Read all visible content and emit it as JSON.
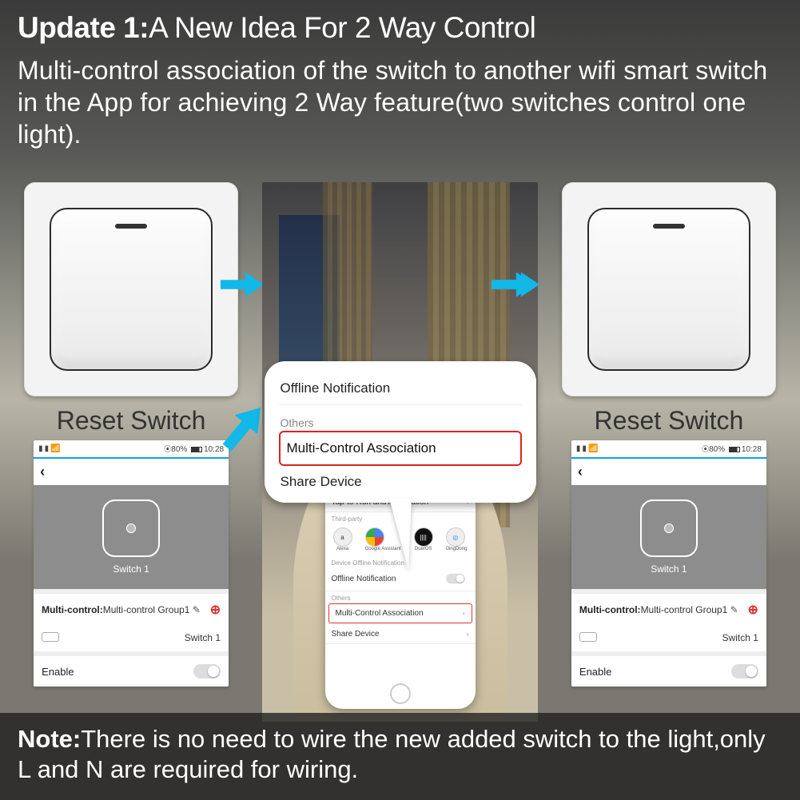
{
  "header": {
    "title_prefix": "Update 1:",
    "title_rest": "A New Idea For 2 Way Control",
    "subtitle": "Multi-control association of the switch to another wifi smart switch in the App for achieving 2 Way feature(two switches control one light)."
  },
  "note": {
    "prefix": "Note:",
    "body": "There is no need to wire the new added switch to the light,only L and N are required for wiring."
  },
  "switch_label": "Reset Switch",
  "statusbar": {
    "battery": "80%",
    "time": "10:28"
  },
  "phone": {
    "device_name": "Switch 1",
    "mc_label": "Multi-control:",
    "mc_value": "Multi-control Group1",
    "switch_item": "Switch 1",
    "enable": "Enable"
  },
  "center_phone": {
    "tap_run": "Tap-to-Run and Automation",
    "third_party": "Third-party",
    "apps": [
      "Alexa",
      "Google Assistant",
      "DuerOS",
      "DingDong"
    ],
    "offline": "Offline Notification",
    "others": "Others",
    "mca": "Multi-Control Association",
    "share": "Share Device"
  },
  "callout": {
    "row1": "Offline Notification",
    "row2_label": "Others",
    "row3": "Multi-Control Association",
    "row4": "Share Device"
  },
  "icons": {
    "arrow": "arrow-right-icon",
    "edit": "edit-icon",
    "plus": "plus-icon",
    "toggle": "toggle-icon",
    "back": "back-icon"
  },
  "colors": {
    "arrow": "#12b8e8",
    "hot_border": "#d22"
  }
}
